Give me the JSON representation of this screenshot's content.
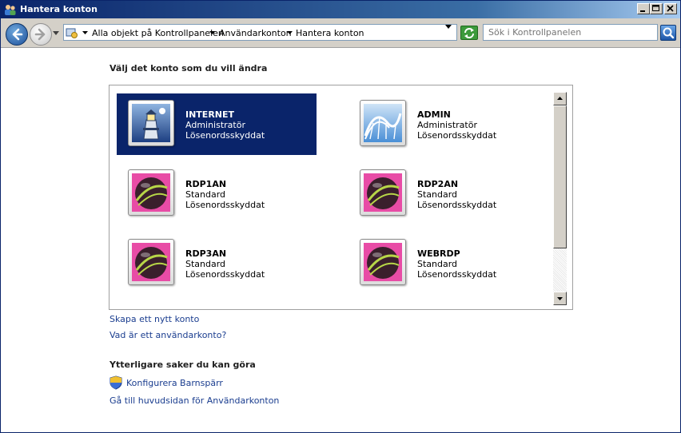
{
  "window": {
    "title": "Hantera konton"
  },
  "address_bar": {
    "breadcrumbs": [
      "Alla objekt på Kontrollpanelen",
      "Användarkonton",
      "Hantera konton"
    ],
    "search_placeholder": "Sök i Kontrollpanelen"
  },
  "main": {
    "heading": "Välj det konto som du vill ändra",
    "accounts": [
      {
        "name": "INTERNET",
        "type": "Administratör",
        "status": "Lösenordsskyddat",
        "picture": "lighthouse-icon",
        "selected": true
      },
      {
        "name": "ADMIN",
        "type": "Administratör",
        "status": "Lösenordsskyddat",
        "picture": "rollercoaster-icon",
        "selected": false
      },
      {
        "name": "RDP1AN",
        "type": "Standard",
        "status": "Lösenordsskyddat",
        "picture": "ball-icon",
        "selected": false
      },
      {
        "name": "RDP2AN",
        "type": "Standard",
        "status": "Lösenordsskyddat",
        "picture": "ball-icon",
        "selected": false
      },
      {
        "name": "RDP3AN",
        "type": "Standard",
        "status": "Lösenordsskyddat",
        "picture": "ball-icon",
        "selected": false
      },
      {
        "name": "WEBRDP",
        "type": "Standard",
        "status": "Lösenordsskyddat",
        "picture": "ball-icon",
        "selected": false
      }
    ],
    "links": {
      "create_account": "Skapa ett nytt konto",
      "what_is_account": "Vad är ett användarkonto?"
    }
  },
  "more": {
    "heading": "Ytterligare saker du kan göra",
    "parental_controls": "Konfigurera Barnspärr",
    "main_page": "Gå till huvudsidan för Användarkonton"
  },
  "colors": {
    "selection": "#0a246a",
    "link": "#1a3d8f"
  }
}
